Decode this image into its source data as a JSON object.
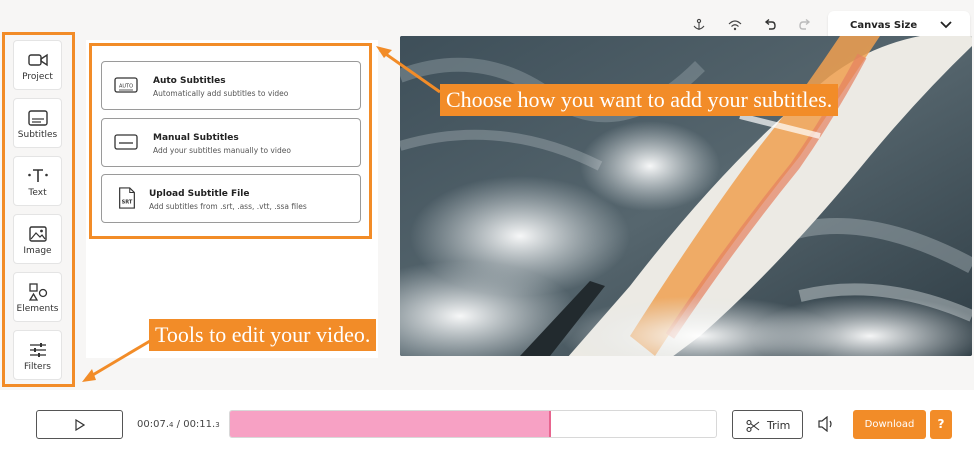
{
  "sidebar": {
    "items": [
      {
        "label": "Project",
        "icon": "video-camera-icon"
      },
      {
        "label": "Subtitles",
        "icon": "subtitles-icon"
      },
      {
        "label": "Text",
        "icon": "text-icon"
      },
      {
        "label": "Image",
        "icon": "image-icon"
      },
      {
        "label": "Elements",
        "icon": "shapes-icon"
      },
      {
        "label": "Filters",
        "icon": "sliders-icon"
      }
    ]
  },
  "subtitles_panel": {
    "options": [
      {
        "title": "Auto Subtitles",
        "description": "Automatically add subtitles to video",
        "icon": "auto-icon",
        "icon_text": "AUTO"
      },
      {
        "title": "Manual Subtitles",
        "description": "Add your subtitles manually to video",
        "icon": "keyboard-subtitle-icon"
      },
      {
        "title": "Upload Subtitle File",
        "description": "Add subtitles from .srt, .ass, .vtt, .ssa files",
        "icon": "srt-file-icon",
        "icon_text": "SRT"
      }
    ]
  },
  "toolbar": {
    "icons": [
      "anchor-icon",
      "wifi-icon",
      "undo-icon",
      "redo-icon"
    ],
    "canvas_size_label": "Canvas Size"
  },
  "callouts": {
    "subtitles": "Choose how you want to add your subtitles.",
    "tools": "Tools to edit your video."
  },
  "player": {
    "current_time": "00:07.",
    "current_time_frac": "4",
    "total_time": "00:11.",
    "total_time_frac": "3",
    "separator": " / ",
    "progress_fraction": 0.661,
    "trim_label": "Trim",
    "download_label": "Download",
    "help_label": "?"
  },
  "colors": {
    "accent": "#f28c28",
    "progress_fill": "#f7a1c4"
  }
}
